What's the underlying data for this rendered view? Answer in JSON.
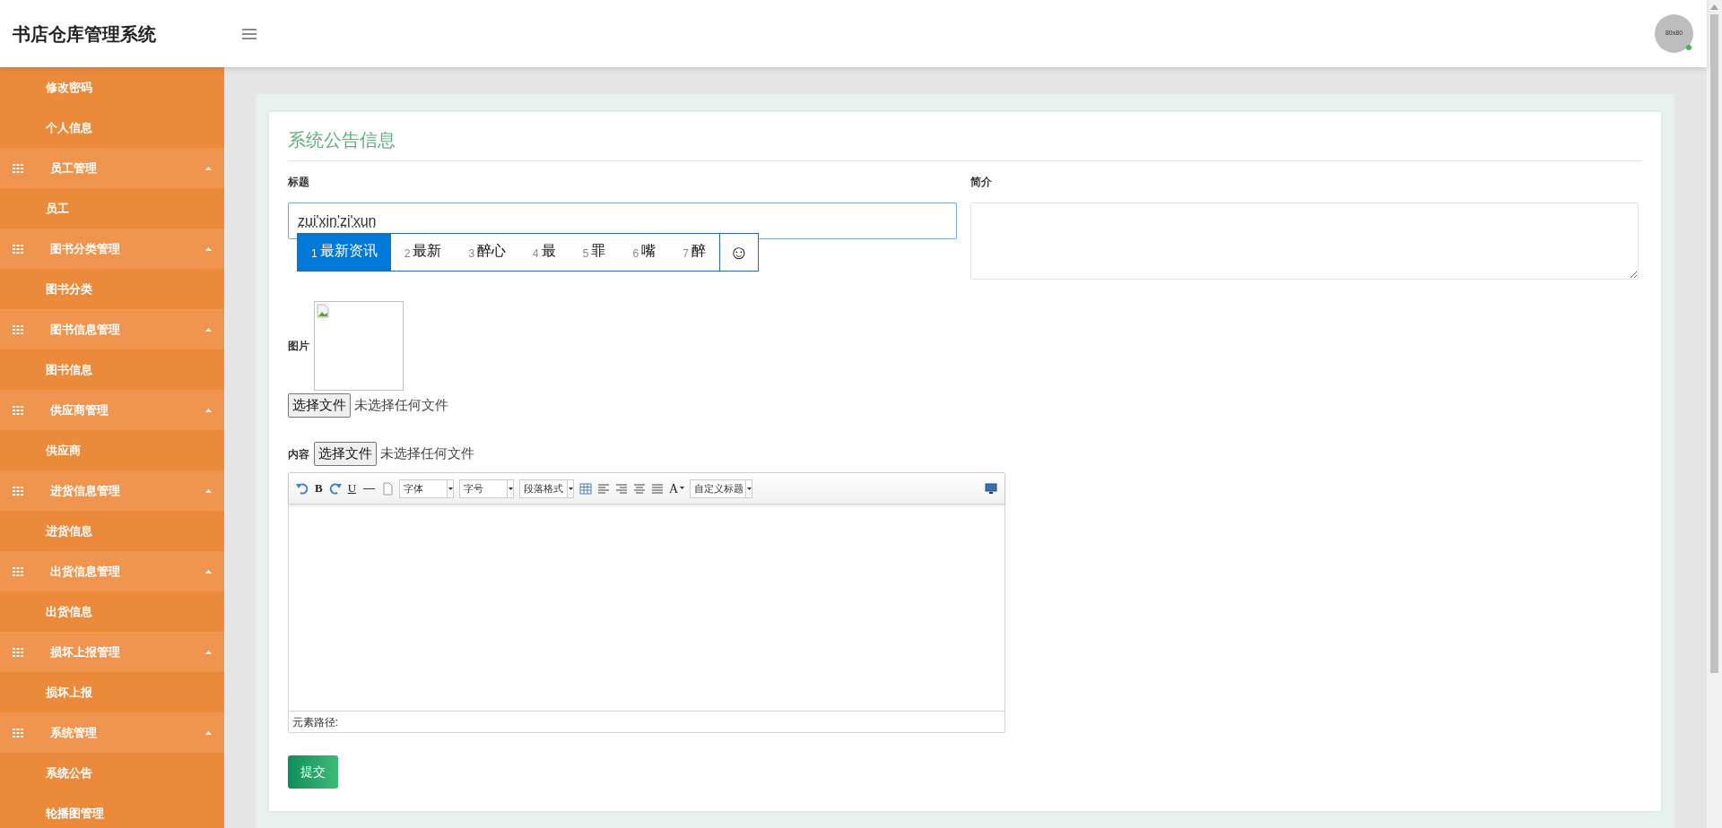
{
  "header": {
    "title": "书店仓库管理系统",
    "avatar_text": "80x80",
    "online": true
  },
  "sidebar": {
    "items": [
      {
        "kind": "link",
        "label": "修改密码"
      },
      {
        "kind": "link",
        "label": "个人信息"
      },
      {
        "kind": "group",
        "label": "员工管理",
        "expanded": true,
        "children": [
          {
            "label": "员工"
          }
        ]
      },
      {
        "kind": "group",
        "label": "图书分类管理",
        "expanded": true,
        "children": [
          {
            "label": "图书分类"
          }
        ]
      },
      {
        "kind": "group",
        "label": "图书信息管理",
        "expanded": true,
        "children": [
          {
            "label": "图书信息"
          }
        ]
      },
      {
        "kind": "group",
        "label": "供应商管理",
        "expanded": true,
        "children": [
          {
            "label": "供应商"
          }
        ]
      },
      {
        "kind": "group",
        "label": "进货信息管理",
        "expanded": true,
        "children": [
          {
            "label": "进货信息"
          }
        ]
      },
      {
        "kind": "group",
        "label": "出货信息管理",
        "expanded": true,
        "children": [
          {
            "label": "出货信息"
          }
        ]
      },
      {
        "kind": "group",
        "label": "损坏上报管理",
        "expanded": true,
        "children": [
          {
            "label": "损坏上报"
          }
        ]
      },
      {
        "kind": "group",
        "label": "系统管理",
        "expanded": true,
        "children": [
          {
            "label": "系统公告"
          },
          {
            "label": "轮播图管理"
          }
        ]
      }
    ]
  },
  "form": {
    "heading": "系统公告信息",
    "title_field": {
      "label": "标题",
      "value": "zui'xin'zi'xun"
    },
    "summary_field": {
      "label": "简介"
    },
    "ime": {
      "candidates": [
        {
          "number": "1",
          "text": "最新资讯",
          "selected": true
        },
        {
          "number": "2",
          "text": "最新",
          "selected": false
        },
        {
          "number": "3",
          "text": "醉心",
          "selected": false
        },
        {
          "number": "4",
          "text": "最",
          "selected": false
        },
        {
          "number": "5",
          "text": "罪",
          "selected": false
        },
        {
          "number": "6",
          "text": "嘴",
          "selected": false
        },
        {
          "number": "7",
          "text": "醉",
          "selected": false
        }
      ],
      "emoji": "☺"
    },
    "image_field": {
      "label": "图片",
      "button": "选择文件",
      "status": "未选择任何文件"
    },
    "content_field": {
      "label": "内容",
      "button": "选择文件",
      "status": "未选择任何文件"
    },
    "editor": {
      "toolbar": [
        {
          "kind": "undo"
        },
        {
          "kind": "bold",
          "text": "B"
        },
        {
          "kind": "redo"
        },
        {
          "kind": "underline",
          "text": "U"
        },
        {
          "kind": "rule",
          "text": "—"
        },
        {
          "kind": "page"
        },
        {
          "kind": "select",
          "text": "字体"
        },
        {
          "kind": "select",
          "text": "字号"
        },
        {
          "kind": "select",
          "text": "段落格式"
        },
        {
          "kind": "table"
        },
        {
          "kind": "align-left"
        },
        {
          "kind": "align-right"
        },
        {
          "kind": "align-center"
        },
        {
          "kind": "justify"
        },
        {
          "kind": "color",
          "text": "A"
        },
        {
          "kind": "select",
          "text": "自定义标题"
        },
        {
          "kind": "fullscreen"
        }
      ],
      "path_label": "元素路径:"
    },
    "submit": "提交"
  }
}
